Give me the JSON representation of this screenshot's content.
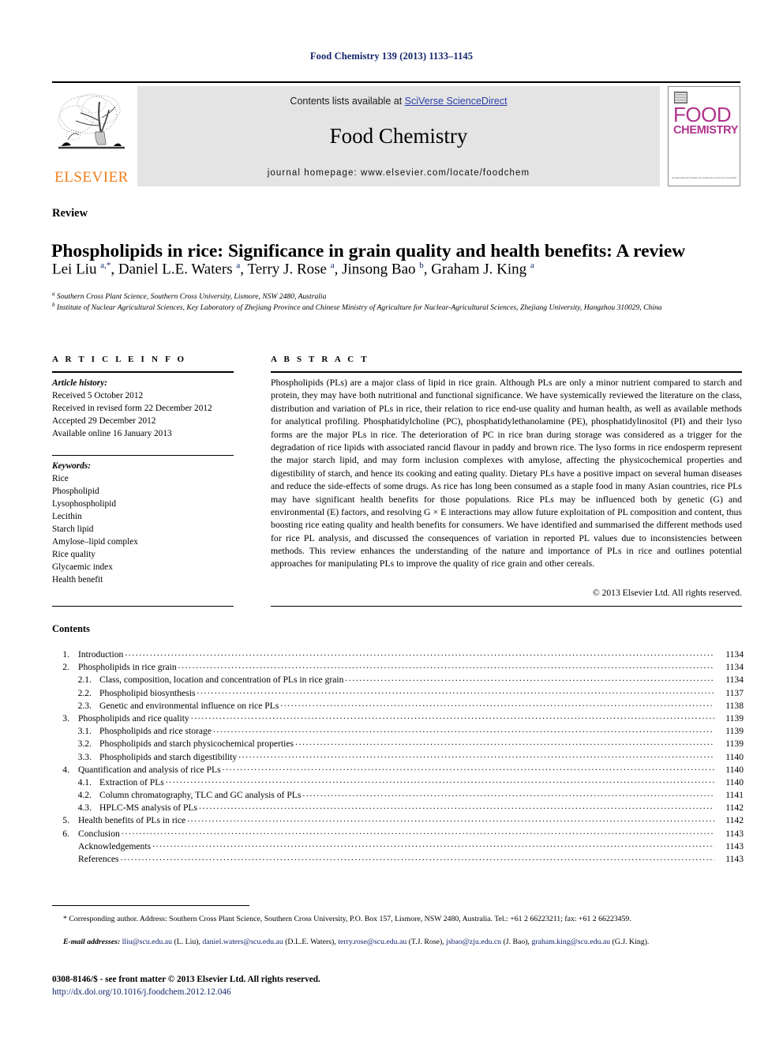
{
  "running_head": "Food Chemistry 139 (2013) 1133–1145",
  "masthead": {
    "publisher_name": "ELSEVIER",
    "contents_prefix": "Contents lists available at ",
    "contents_link": "SciVerse ScienceDirect",
    "journal_title": "Food Chemistry",
    "homepage": "journal homepage: www.elsevier.com/locate/foodchem",
    "cover": {
      "line1": "FOOD",
      "line2": "CHEMISTRY",
      "footer": "An International Journal\nwww.elsevier.com/locate/foodchem"
    }
  },
  "article": {
    "doctype": "Review",
    "title": "Phospholipids in rice: Significance in grain quality and health benefits: A review",
    "authors_html": "Lei Liu <sup>a,*</sup>, Daniel L.E. Waters <sup>a</sup>, Terry J. Rose <sup>a</sup>, Jinsong Bao <sup>b</sup>, Graham J. King <sup>a</sup>",
    "affiliation_a": "Southern Cross Plant Science, Southern Cross University, Lismore, NSW 2480, Australia",
    "affiliation_b": "Institute of Nuclear Agricultural Sciences, Key Laboratory of Zhejiang Province and Chinese Ministry of Agriculture for Nuclear-Agricultural Sciences, Zhejiang University, Hangzhou 310029, China"
  },
  "article_info": {
    "heading": "A R T I C L E  I N F O",
    "history_label": "Article history:",
    "history": [
      "Received 5 October 2012",
      "Received in revised form 22 December 2012",
      "Accepted 29 December 2012",
      "Available online 16 January 2013"
    ],
    "keywords_label": "Keywords:",
    "keywords": [
      "Rice",
      "Phospholipid",
      "Lysophospholipid",
      "Lecithin",
      "Starch lipid",
      "Amylose–lipid complex",
      "Rice quality",
      "Glycaemic index",
      "Health benefit"
    ]
  },
  "abstract": {
    "heading": "A B S T R A C T",
    "text": "Phospholipids (PLs) are a major class of lipid in rice grain. Although PLs are only a minor nutrient compared to starch and protein, they may have both nutritional and functional significance. We have systemically reviewed the literature on the class, distribution and variation of PLs in rice, their relation to rice end-use quality and human health, as well as available methods for analytical profiling. Phosphatidylcholine (PC), phosphatidylethanolamine (PE), phosphatidylinositol (PI) and their lyso forms are the major PLs in rice. The deterioration of PC in rice bran during storage was considered as a trigger for the degradation of rice lipids with associated rancid flavour in paddy and brown rice. The lyso forms in rice endosperm represent the major starch lipid, and may form inclusion complexes with amylose, affecting the physicochemical properties and digestibility of starch, and hence its cooking and eating quality. Dietary PLs have a positive impact on several human diseases and reduce the side-effects of some drugs. As rice has long been consumed as a staple food in many Asian countries, rice PLs may have significant health benefits for those populations. Rice PLs may be influenced both by genetic (G) and environmental (E) factors, and resolving G × E interactions may allow future exploitation of PL composition and content, thus boosting rice eating quality and health benefits for consumers. We have identified and summarised the different methods used for rice PL analysis, and discussed the consequences of variation in reported PL values due to inconsistencies between methods. This review enhances the understanding of the nature and importance of PLs in rice and outlines potential approaches for manipulating PLs to improve the quality of rice grain and other cereals.",
    "copyright": "© 2013 Elsevier Ltd. All rights reserved."
  },
  "contents": {
    "heading": "Contents",
    "entries": [
      {
        "num": "1.",
        "level": 1,
        "label": "Introduction",
        "page": "1134"
      },
      {
        "num": "2.",
        "level": 1,
        "label": "Phospholipids in rice grain",
        "page": "1134"
      },
      {
        "num": "2.1.",
        "level": 2,
        "label": "Class, composition, location and concentration of PLs in rice grain",
        "page": "1134"
      },
      {
        "num": "2.2.",
        "level": 2,
        "label": "Phospholipid biosynthesis",
        "page": "1137"
      },
      {
        "num": "2.3.",
        "level": 2,
        "label": "Genetic and environmental influence on rice PLs",
        "page": "1138"
      },
      {
        "num": "3.",
        "level": 1,
        "label": "Phospholipids and rice quality",
        "page": "1139"
      },
      {
        "num": "3.1.",
        "level": 2,
        "label": "Phospholipids and rice storage",
        "page": "1139"
      },
      {
        "num": "3.2.",
        "level": 2,
        "label": "Phospholipids and starch physicochemical properties",
        "page": "1139"
      },
      {
        "num": "3.3.",
        "level": 2,
        "label": "Phospholipids and starch digestibility",
        "page": "1140"
      },
      {
        "num": "4.",
        "level": 1,
        "label": "Quantification and analysis of rice PLs",
        "page": "1140"
      },
      {
        "num": "4.1.",
        "level": 2,
        "label": "Extraction of PLs",
        "page": "1140"
      },
      {
        "num": "4.2.",
        "level": 2,
        "label": "Column chromatography, TLC and GC analysis of PLs",
        "page": "1141"
      },
      {
        "num": "4.3.",
        "level": 2,
        "label": "HPLC-MS analysis of PLs",
        "page": "1142"
      },
      {
        "num": "5.",
        "level": 1,
        "label": "Health benefits of PLs in rice",
        "page": "1142"
      },
      {
        "num": "6.",
        "level": 1,
        "label": "Conclusion",
        "page": "1143"
      },
      {
        "num": "",
        "level": 1,
        "label": "Acknowledgements",
        "page": "1143"
      },
      {
        "num": "",
        "level": 1,
        "label": "References",
        "page": "1143"
      }
    ]
  },
  "footnotes": {
    "corresponding": "* Corresponding author. Address: Southern Cross Plant Science, Southern Cross University, P.O. Box 157, Lismore, NSW 2480, Australia. Tel.: +61 2 66223211; fax: +61 2 66223459.",
    "emails_label": "E-mail addresses:",
    "emails": [
      {
        "address": "lliu@scu.edu.au",
        "owner": "(L. Liu)"
      },
      {
        "address": "daniel.waters@scu.edu.au",
        "owner": "(D.L.E. Waters)"
      },
      {
        "address": "terry.rose@scu.edu.au",
        "owner": "(T.J. Rose)"
      },
      {
        "address": "jsbao@zju.edu.cn",
        "owner": "(J. Bao)"
      },
      {
        "address": "graham.king@scu.edu.au",
        "owner": "(G.J. King)"
      }
    ],
    "issn_line": "0308-8146/$ - see front matter © 2013 Elsevier Ltd. All rights reserved.",
    "doi_line": "http://dx.doi.org/10.1016/j.foodchem.2012.12.046"
  },
  "colors": {
    "navy": "#12246b",
    "link_blue": "#2b3faa",
    "elsevier_orange": "#f07d1a",
    "cover_magenta": "#b0338c",
    "band_grey": "#e4e4e4"
  }
}
